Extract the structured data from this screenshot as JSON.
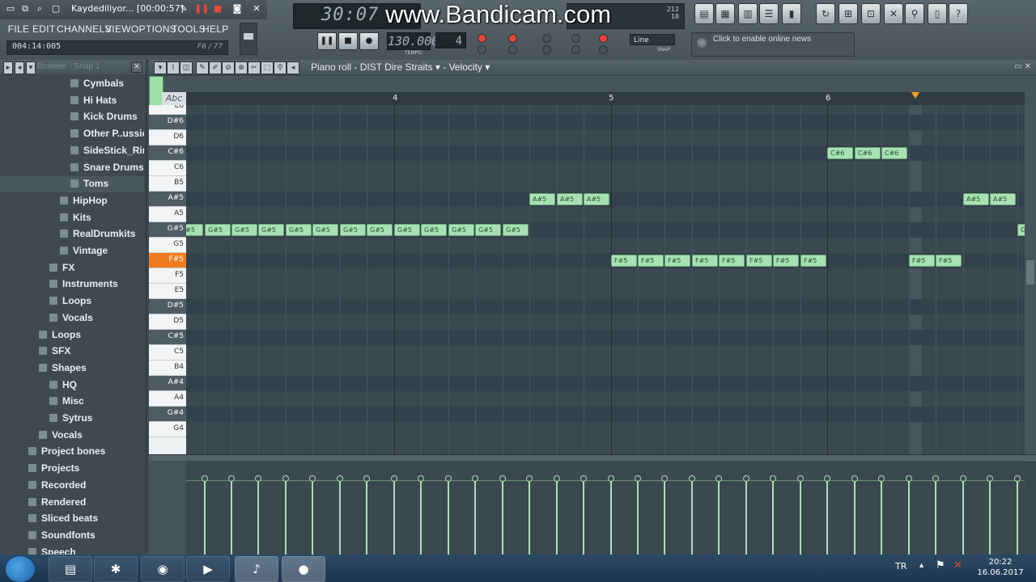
{
  "recorder": {
    "title": "Kaydediliyor... [00:00:57]"
  },
  "watermark": "www.Bandicam.com",
  "menu": [
    "FILE",
    "EDIT",
    "CHANNELS",
    "VIEW",
    "OPTIONS",
    "TOOLS",
    "HELP"
  ],
  "hint": {
    "time": "004:14:005",
    "right": "F6 / 77"
  },
  "lcd": {
    "time": "30:07"
  },
  "transport": {
    "tempo": "130.000",
    "tempo_label": "TEMPO",
    "pattern": "4",
    "snap": "Line",
    "snap_label": "SNAP"
  },
  "cpu": {
    "line1": "212",
    "line2": "18"
  },
  "news": {
    "text": "Click to enable online news"
  },
  "browser": {
    "title": "Browser - Snap 1",
    "items": [
      {
        "label": "Cymbals",
        "depth": 5
      },
      {
        "label": "Hi Hats",
        "depth": 5
      },
      {
        "label": "Kick Drums",
        "depth": 5
      },
      {
        "label": "Other P..ussion",
        "depth": 5
      },
      {
        "label": "SideStick_Rims",
        "depth": 5
      },
      {
        "label": "Snare Drums",
        "depth": 5
      },
      {
        "label": "Toms",
        "depth": 5,
        "selected": true
      },
      {
        "label": "HipHop",
        "depth": 4
      },
      {
        "label": "Kits",
        "depth": 4
      },
      {
        "label": "RealDrumkits",
        "depth": 4
      },
      {
        "label": "Vintage",
        "depth": 4
      },
      {
        "label": "FX",
        "depth": 3
      },
      {
        "label": "Instruments",
        "depth": 3
      },
      {
        "label": "Loops",
        "depth": 3
      },
      {
        "label": "Vocals",
        "depth": 3
      },
      {
        "label": "Loops",
        "depth": 2
      },
      {
        "label": "SFX",
        "depth": 2
      },
      {
        "label": "Shapes",
        "depth": 2
      },
      {
        "label": "HQ",
        "depth": 3
      },
      {
        "label": "Misc",
        "depth": 3
      },
      {
        "label": "Sytrus",
        "depth": 3
      },
      {
        "label": "Vocals",
        "depth": 2
      },
      {
        "label": "Project bones",
        "depth": 1
      },
      {
        "label": "Projects",
        "depth": 1
      },
      {
        "label": "Recorded",
        "depth": 1
      },
      {
        "label": "Rendered",
        "depth": 1
      },
      {
        "label": "Sliced beats",
        "depth": 1
      },
      {
        "label": "Soundfonts",
        "depth": 1
      },
      {
        "label": "Speech",
        "depth": 1
      }
    ]
  },
  "piano_roll": {
    "title": "Piano roll - DIST Dire Straits",
    "target": "Velocity",
    "abc": "Abc",
    "bar_numbers": [
      "4",
      "5",
      "6"
    ],
    "active_key": "F#5",
    "keys": [
      "E6",
      "D#6",
      "D6",
      "C#6",
      "C6",
      "B5",
      "A#5",
      "A5",
      "G#5",
      "G5",
      "F#5",
      "F5",
      "E5",
      "D#5",
      "D5",
      "C#5",
      "C5",
      "B4",
      "A#4",
      "A4",
      "G#4",
      "G4"
    ],
    "notes": [
      {
        "pitch": "G#5",
        "steps": [
          -1,
          0,
          1,
          2,
          3,
          4,
          5,
          6,
          7,
          8,
          9,
          10,
          11
        ]
      },
      {
        "pitch": "A#5",
        "steps": [
          12,
          13,
          14
        ]
      },
      {
        "pitch": "F#5",
        "steps": [
          15,
          16,
          17,
          18,
          19,
          20,
          21,
          22
        ]
      },
      {
        "pitch": "C#6",
        "steps": [
          23,
          24,
          25
        ]
      },
      {
        "pitch": "F#5",
        "steps": [
          26,
          27
        ]
      },
      {
        "pitch": "A#5",
        "steps": [
          28,
          29
        ]
      },
      {
        "pitch": "G#5",
        "steps": [
          30
        ]
      }
    ],
    "velocity_steps": 31
  },
  "taskbar": {
    "apps": [
      "folder-app",
      "bluetooth-app",
      "chrome-app",
      "media-app",
      "fl-studio-app",
      "bandicam-app"
    ],
    "lang": "TR",
    "time": "20:22",
    "date": "16.06.2017"
  }
}
